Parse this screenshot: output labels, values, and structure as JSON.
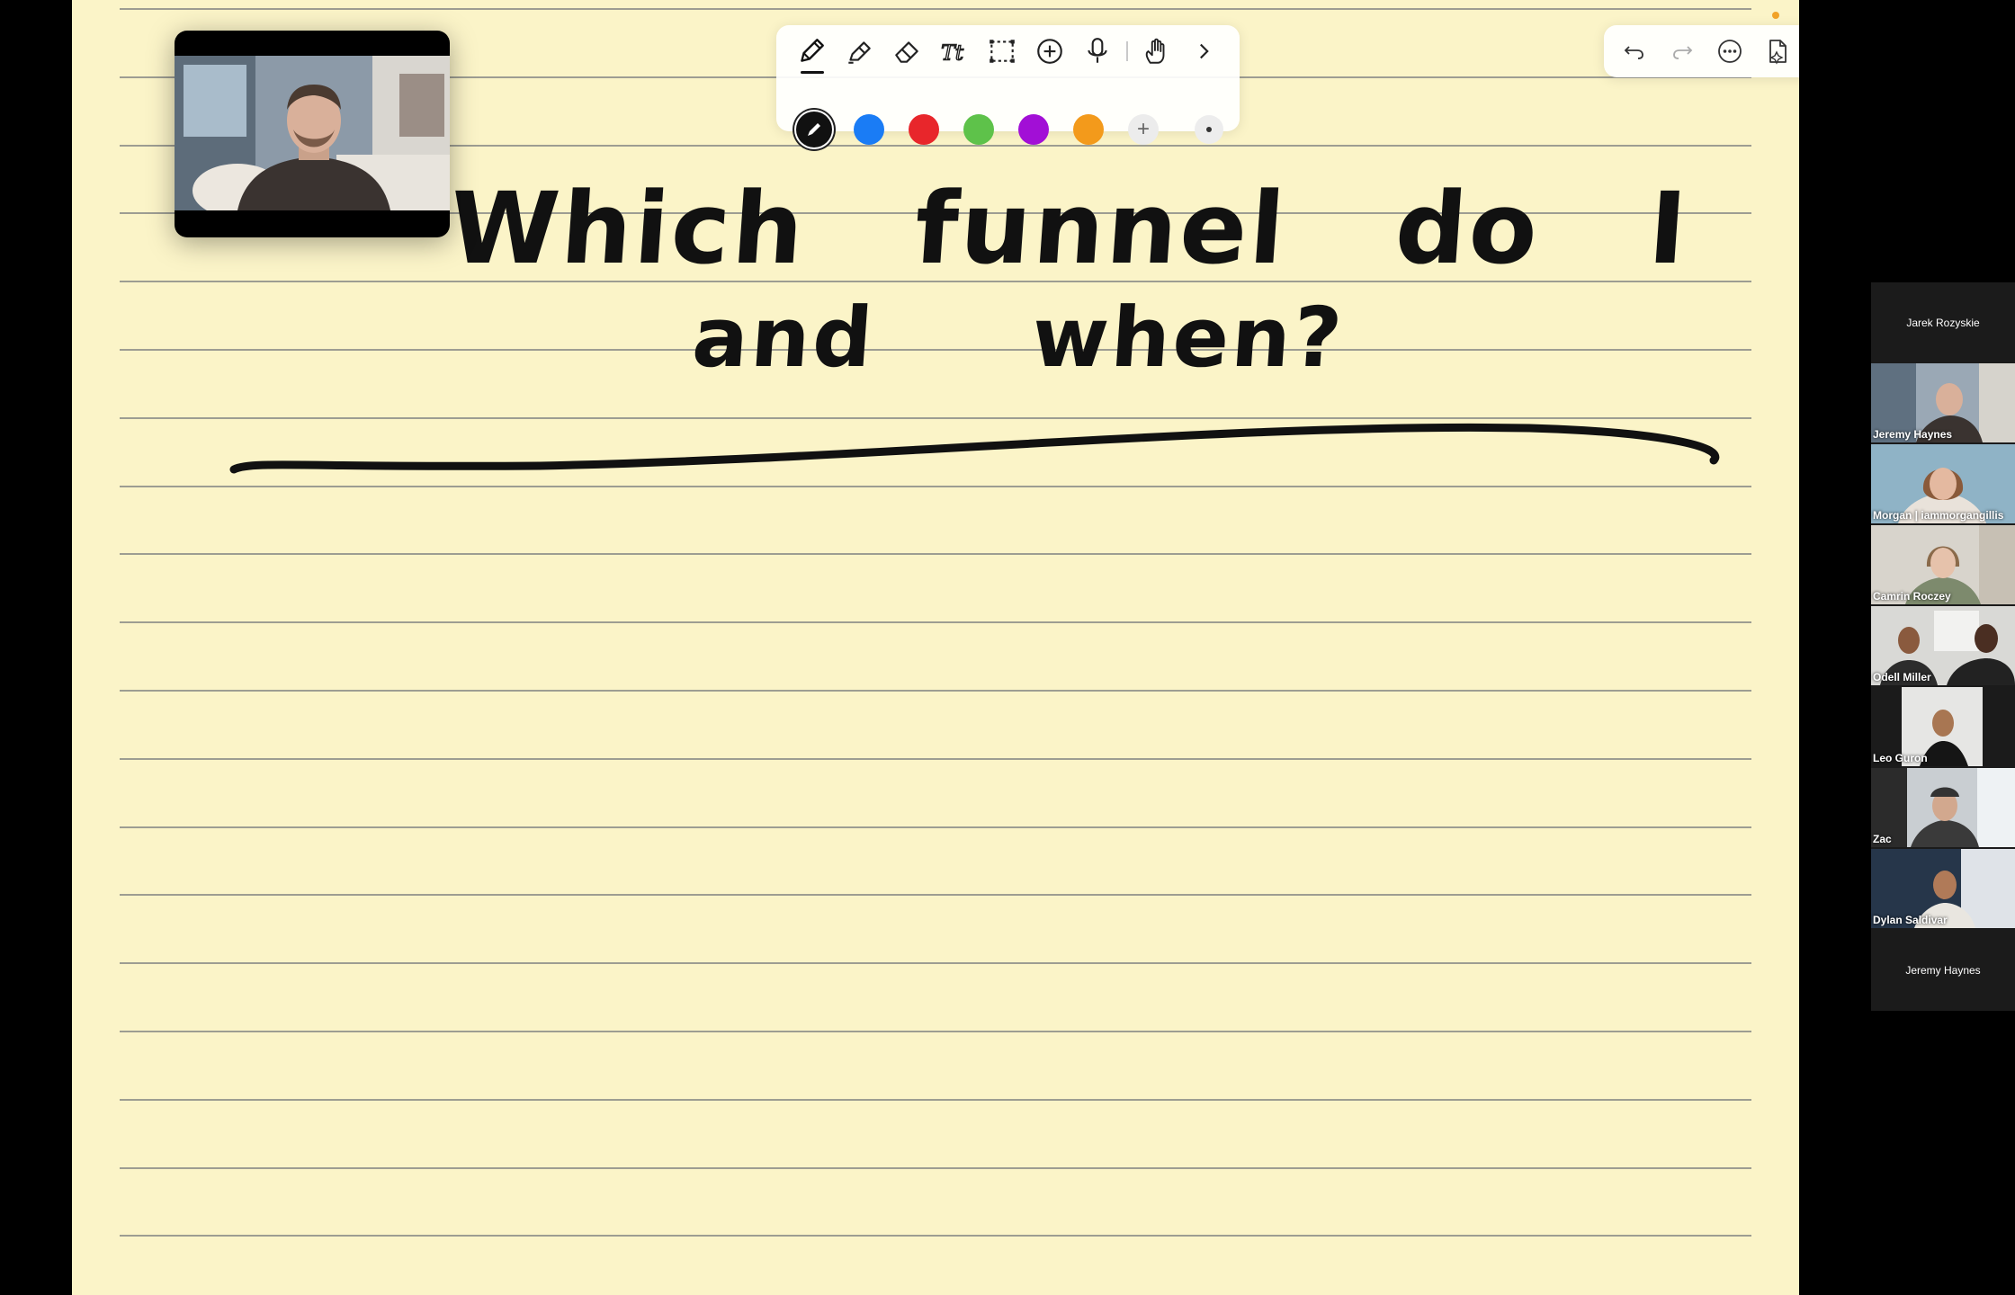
{
  "notes": {
    "handwriting": {
      "line1": "Which funnel do I need",
      "line2": "and when?"
    }
  },
  "toolbar": {
    "tools": [
      "pencil-icon",
      "highlighter-icon",
      "eraser-icon",
      "text-icon",
      "lasso-icon",
      "add-icon",
      "microphone-icon",
      "touch-icon",
      "chevron-right-icon"
    ],
    "colors": [
      "#111111",
      "#1a7cf5",
      "#e8262b",
      "#5ec24a",
      "#a20fd6",
      "#f39a1b"
    ],
    "add_color_label": "+"
  },
  "actions": [
    "undo-icon",
    "redo-icon",
    "more-icon",
    "new-page-icon",
    "duplicate-icon"
  ],
  "participants": [
    {
      "name": "Jarek Rozyskie",
      "video": false
    },
    {
      "name": "Jeremy Haynes",
      "video": true
    },
    {
      "name": "Morgan | iammorgangillis",
      "video": true
    },
    {
      "name": "Camrin Roczey",
      "video": true
    },
    {
      "name": "Odell Miller",
      "video": true
    },
    {
      "name": "Leo Guron",
      "video": true
    },
    {
      "name": "Zac",
      "video": true
    },
    {
      "name": "Dylan Saldivar",
      "video": true
    },
    {
      "name": "Jeremy Haynes",
      "video": false
    }
  ],
  "colors": {
    "paper": "#fbf4c8",
    "rule": "#9d9d92",
    "ink": "#111111",
    "accent": "#f1a228"
  }
}
